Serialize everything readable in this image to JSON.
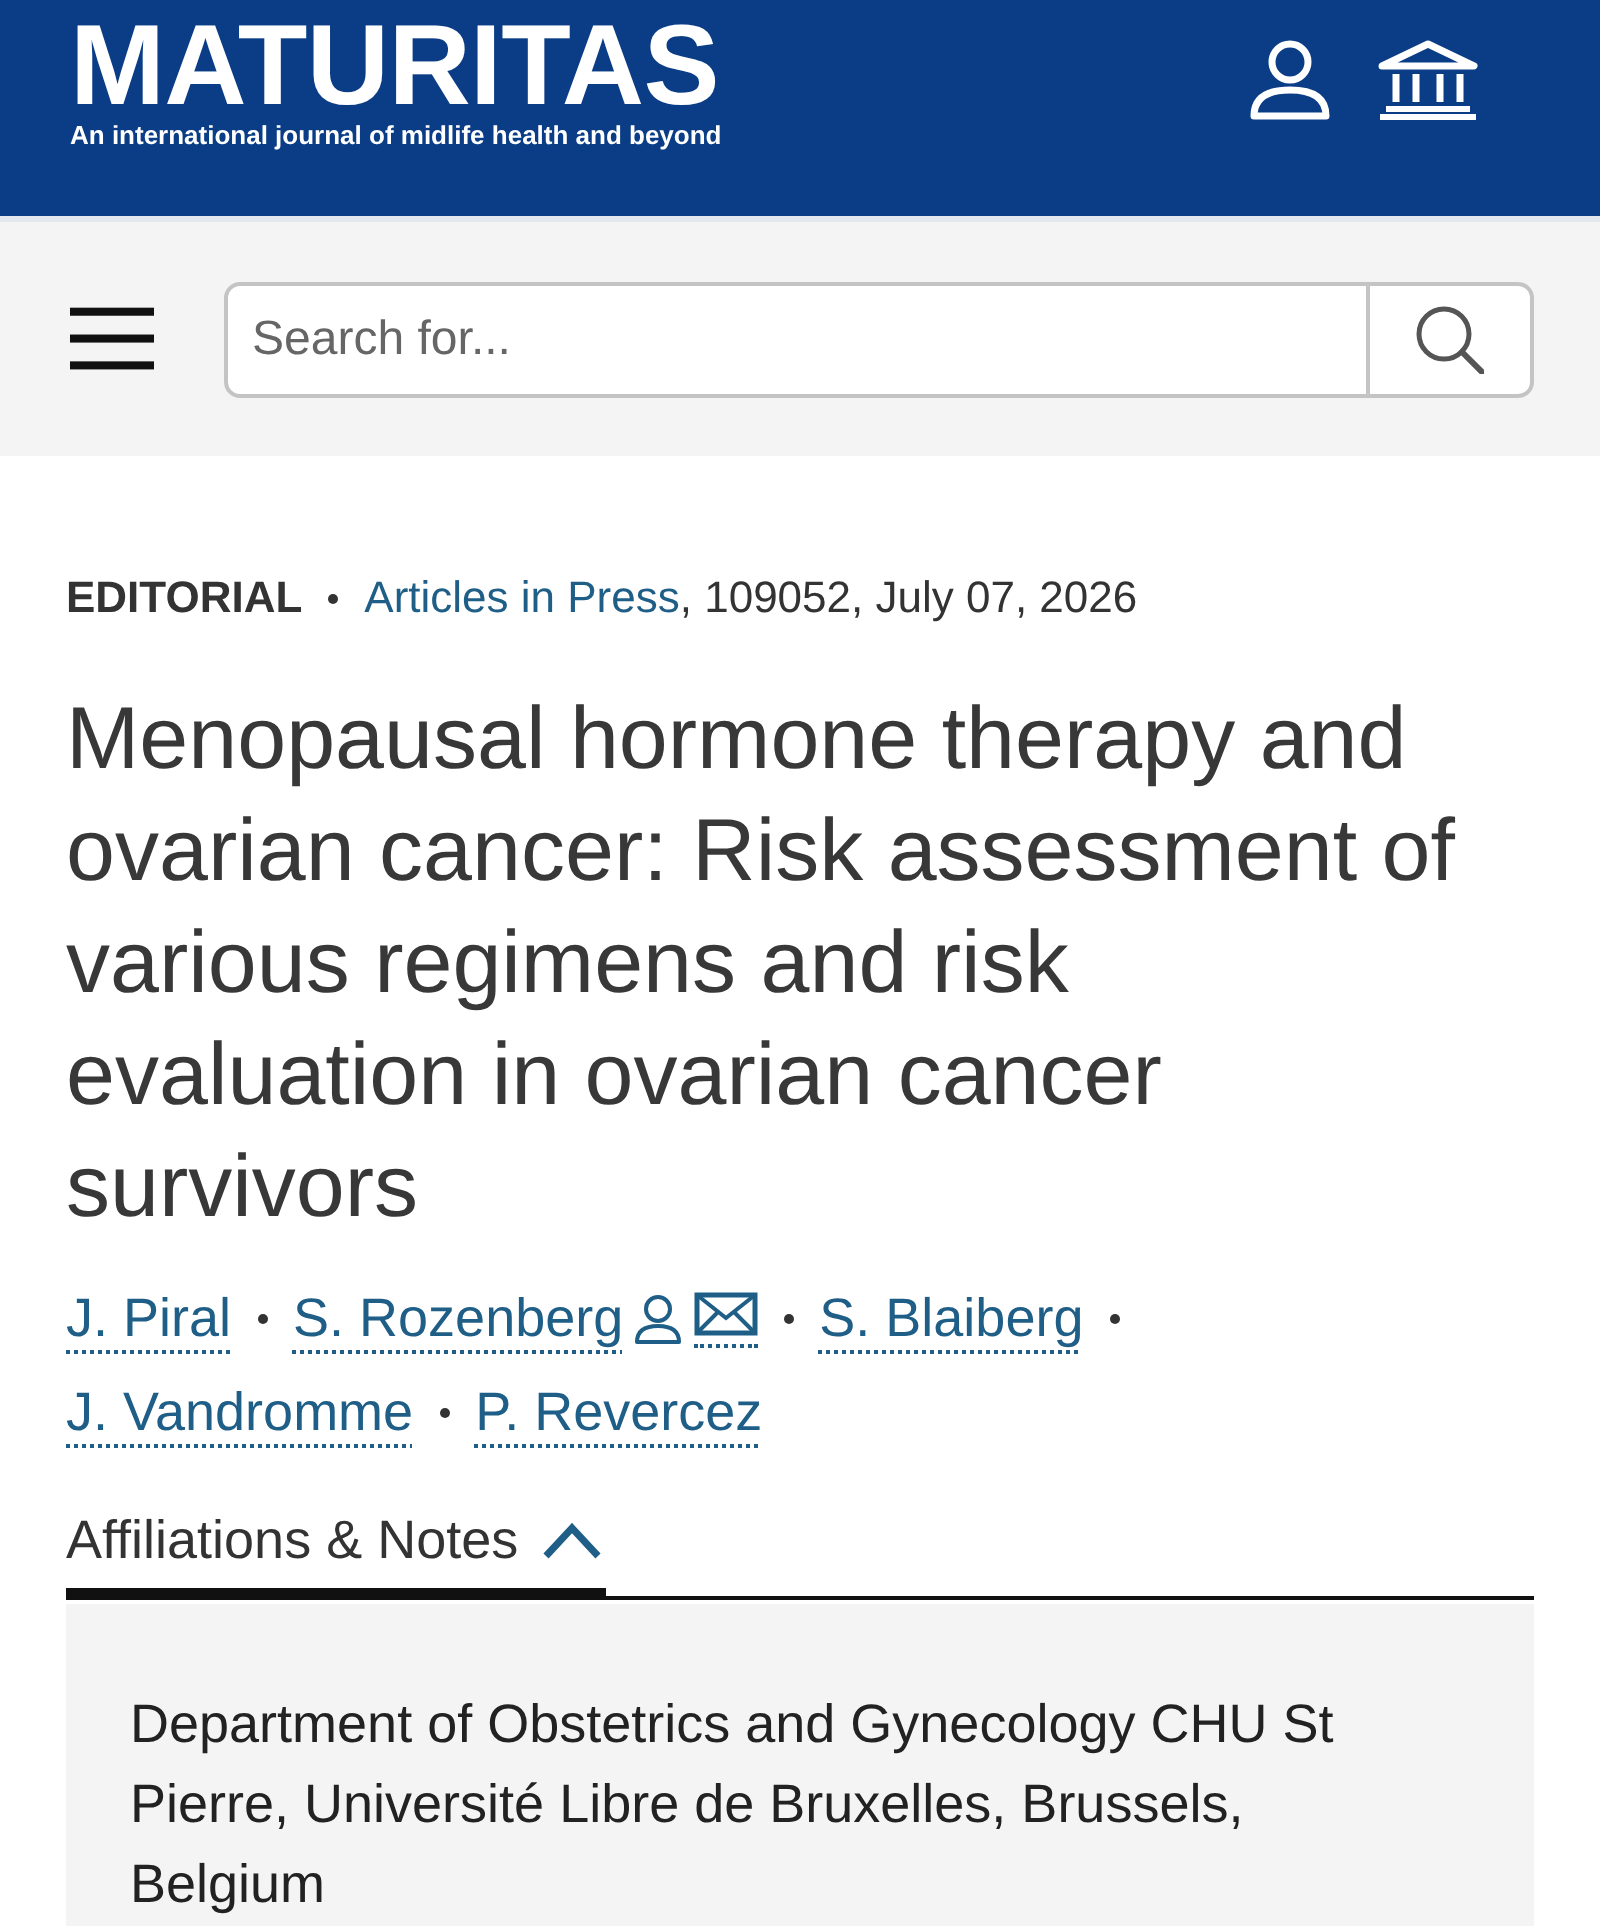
{
  "header": {
    "logo": "MATURITAS",
    "tagline": "An international journal of midlife health and beyond"
  },
  "search": {
    "placeholder": "Search for..."
  },
  "article": {
    "type": "EDITORIAL",
    "collection": "Articles in Press",
    "details": ", 109052, July 07, 2026",
    "title": "Menopausal hormone therapy and ovarian cancer: Risk assessment of various regimens and risk evaluation in ovarian cancer survivors",
    "authors": [
      {
        "name": "J. Piral",
        "corresponding": false
      },
      {
        "name": "S. Rozenberg",
        "corresponding": true
      },
      {
        "name": "S. Blaiberg",
        "corresponding": false
      },
      {
        "name": "J. Vandromme",
        "corresponding": false
      },
      {
        "name": "P. Revercez",
        "corresponding": false
      }
    ]
  },
  "affiliations": {
    "label": "Affiliations & Notes",
    "expanded": true,
    "items": [
      "Department of Obstetrics and Gynecology CHU St Pierre, Université Libre de Bruxelles, Brussels, Belgium"
    ]
  }
}
